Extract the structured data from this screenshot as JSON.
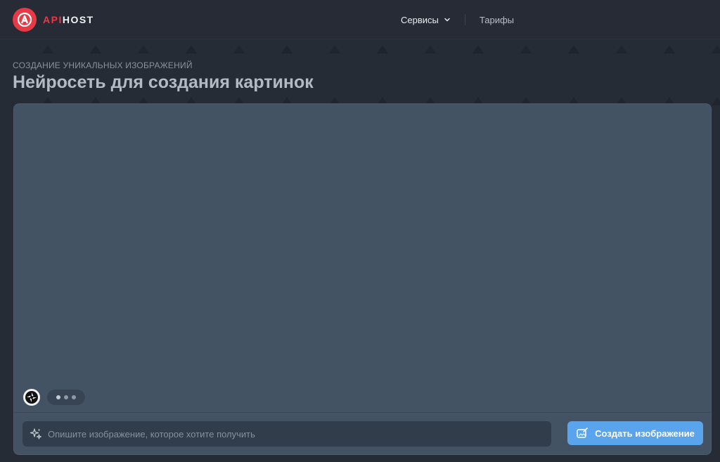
{
  "brand": {
    "name_part1": "API",
    "name_part2": "HOST",
    "accent_color": "#e63b47",
    "logo_icon": "lock-letter-a-icon"
  },
  "nav": {
    "items": [
      {
        "label": "Сервисы",
        "has_dropdown": true,
        "icon": "chevron-down-icon"
      },
      {
        "label": "Тарифы",
        "has_dropdown": false
      }
    ]
  },
  "page": {
    "subtitle": "СОЗДАНИЕ УНИКАЛЬНЫХ ИЗОБРАЖЕНИЙ",
    "title": "Нейросеть для создания картинок"
  },
  "chat": {
    "bot_avatar_icon": "aperture-icon",
    "typing_indicator_icon": "typing-dots-icon"
  },
  "composer": {
    "prompt_icon": "sparkles-icon",
    "placeholder": "Опишите изображение, которое хотите получить",
    "value": "",
    "submit_label": "Создать изображение",
    "submit_icon": "image-edit-icon",
    "submit_color": "#5aa4ee"
  }
}
